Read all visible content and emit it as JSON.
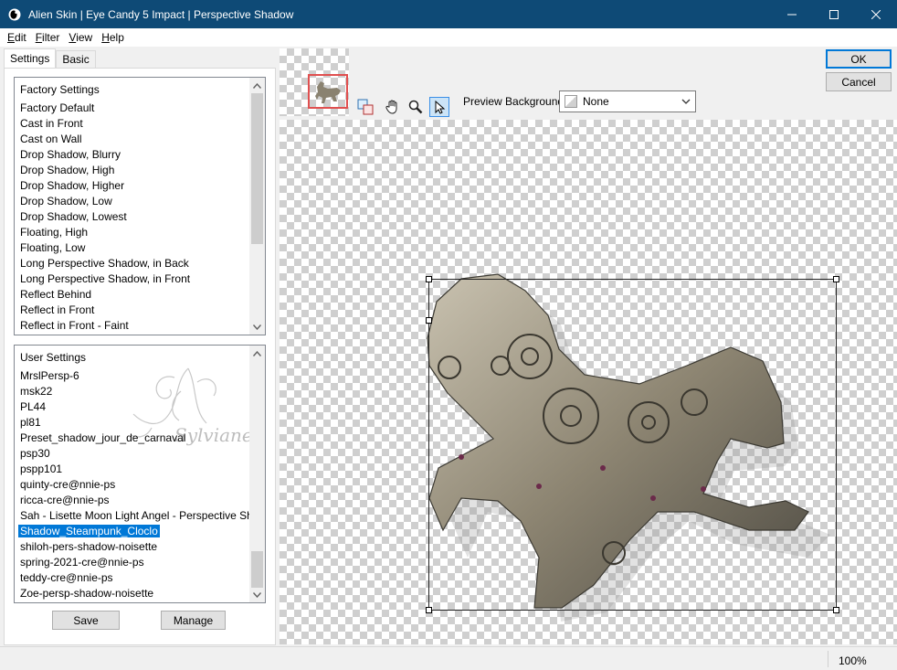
{
  "window": {
    "title": "Alien Skin | Eye Candy 5 Impact | Perspective Shadow"
  },
  "menu": {
    "edit": "dit",
    "edit_u": "E",
    "filter": "ilter",
    "filter_u": "F",
    "view": "iew",
    "view_u": "V",
    "help": "elp",
    "help_u": "H"
  },
  "tabs": {
    "settings": "Settings",
    "basic": "Basic"
  },
  "factory": {
    "heading": "Factory Settings",
    "items": [
      "Factory Default",
      "Cast in Front",
      "Cast on Wall",
      "Drop Shadow, Blurry",
      "Drop Shadow, High",
      "Drop Shadow, Higher",
      "Drop Shadow, Low",
      "Drop Shadow, Lowest",
      "Floating, High",
      "Floating, Low",
      "Long Perspective Shadow, in Back",
      "Long Perspective Shadow, in Front",
      "Reflect Behind",
      "Reflect in Front",
      "Reflect in Front - Faint"
    ]
  },
  "user": {
    "heading": "User Settings",
    "items": [
      "MrslPersp-6",
      "msk22",
      "PL44",
      "pl81",
      "Preset_shadow_jour_de_carnaval",
      "psp30",
      "pspp101",
      "quinty-cre@nnie-ps",
      "ricca-cre@nnie-ps",
      "Sah - Lisette Moon Light Angel - Perspective Shadow",
      "Shadow_Steampunk_Cloclo",
      "shiloh-pers-shadow-noisette",
      "spring-2021-cre@nnie-ps",
      "teddy-cre@nnie-ps",
      "Zoe-persp-shadow-noisette"
    ],
    "selected_index": 10
  },
  "buttons": {
    "save": "Save",
    "manage": "Manage",
    "ok": "OK",
    "cancel": "Cancel"
  },
  "preview": {
    "background_label": "Preview Background:",
    "background_value": "None"
  },
  "status": {
    "zoom": "100%"
  },
  "watermark": "Sylviane"
}
